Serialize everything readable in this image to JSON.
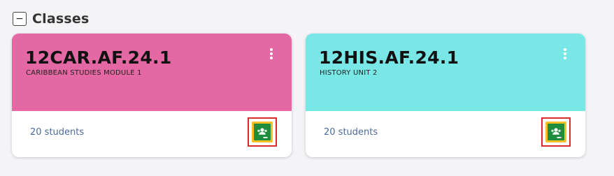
{
  "section": {
    "collapse_symbol": "−",
    "title": "Classes"
  },
  "cards": [
    {
      "code": "12CAR.AF.24.1",
      "subtitle": "CARIBBEAN STUDIES MODULE 1",
      "students": "20 students",
      "color": "#e468a4",
      "menu_icon": "kebab-menu-icon",
      "classroom_icon": "google-classroom-icon"
    },
    {
      "code": "12HIS.AF.24.1",
      "subtitle": "HISTORY UNIT 2",
      "students": "20 students",
      "color": "#78e7e6",
      "menu_icon": "kebab-menu-icon",
      "classroom_icon": "google-classroom-icon"
    }
  ],
  "colors": {
    "highlight_border": "#d92d2d",
    "students_text": "#4c6a98",
    "classroom_green": "#1e8e3e",
    "classroom_yellow": "#f6bf26"
  }
}
